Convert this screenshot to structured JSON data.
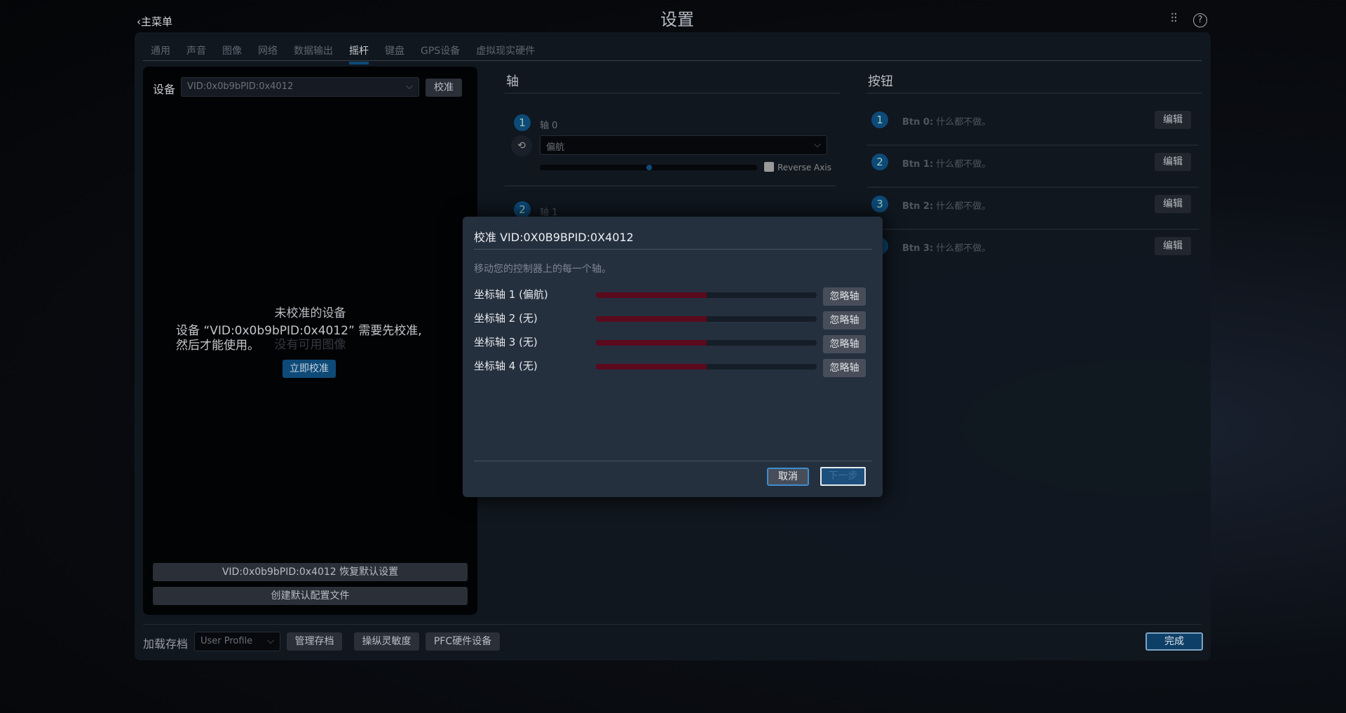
{
  "header": {
    "title": "设置",
    "back_label": "主菜单",
    "icons": [
      "sliders-icon",
      "help-icon"
    ]
  },
  "tabs": [
    {
      "label": "通用"
    },
    {
      "label": "声音"
    },
    {
      "label": "图像"
    },
    {
      "label": "网络"
    },
    {
      "label": "数据输出"
    },
    {
      "label": "摇杆",
      "active": true
    },
    {
      "label": "键盘"
    },
    {
      "label": "GPS设备"
    },
    {
      "label": "虚拟现实硬件"
    }
  ],
  "device": {
    "label": "设备",
    "selected": "VID:0x0b9bPID:0x4012",
    "calibrate_label": "校准",
    "uncalibrated_title": "未校准的设备",
    "message_line1": "设备 “VID:0x0b9bPID:0x4012” 需要先校准,",
    "message_line2": "然后才能使用。",
    "no_image": "没有可用图像",
    "calibrate_now": "立即校准",
    "restore_defaults": "VID:0x0b9bPID:0x4012 恢复默认设置",
    "create_profile": "创建默认配置文件"
  },
  "axes": {
    "heading": "轴",
    "items": [
      {
        "num": "1",
        "label": "轴 0",
        "assignment": "偏航",
        "value": 0.5,
        "reverse_label": "Reverse Axis",
        "reverse": false
      },
      {
        "num": "2",
        "label": "轴 1"
      }
    ]
  },
  "buttons": {
    "heading": "按钮",
    "edit_label": "编辑",
    "items": [
      {
        "num": "1",
        "id": "Btn 0:",
        "action": "什么都不做。"
      },
      {
        "num": "2",
        "id": "Btn 1:",
        "action": "什么都不做。"
      },
      {
        "num": "3",
        "id": "Btn 2:",
        "action": "什么都不做。"
      },
      {
        "num": "4",
        "id": "Btn 3:",
        "action": "什么都不做。"
      }
    ]
  },
  "dialog": {
    "title": "校准 VID:0X0B9BPID:0X4012",
    "instruction": "移动您的控制器上的每一个轴。",
    "ignore_label": "忽略轴",
    "rows": [
      {
        "label": "坐标轴 1 (偏航)",
        "progress": 0.5
      },
      {
        "label": "坐标轴 2 (无)",
        "progress": 0.5
      },
      {
        "label": "坐标轴 3 (无)",
        "progress": 0.5
      },
      {
        "label": "坐标轴 4 (无)",
        "progress": 0.5
      }
    ],
    "cancel": "取消",
    "next": "下一步",
    "bar_color": "#5a0a1c"
  },
  "footer": {
    "load_label": "加载存档",
    "profile": "User Profile",
    "manage": "管理存档",
    "sensitivity": "操纵灵敏度",
    "pfc": "PFC硬件设备",
    "done": "完成"
  }
}
